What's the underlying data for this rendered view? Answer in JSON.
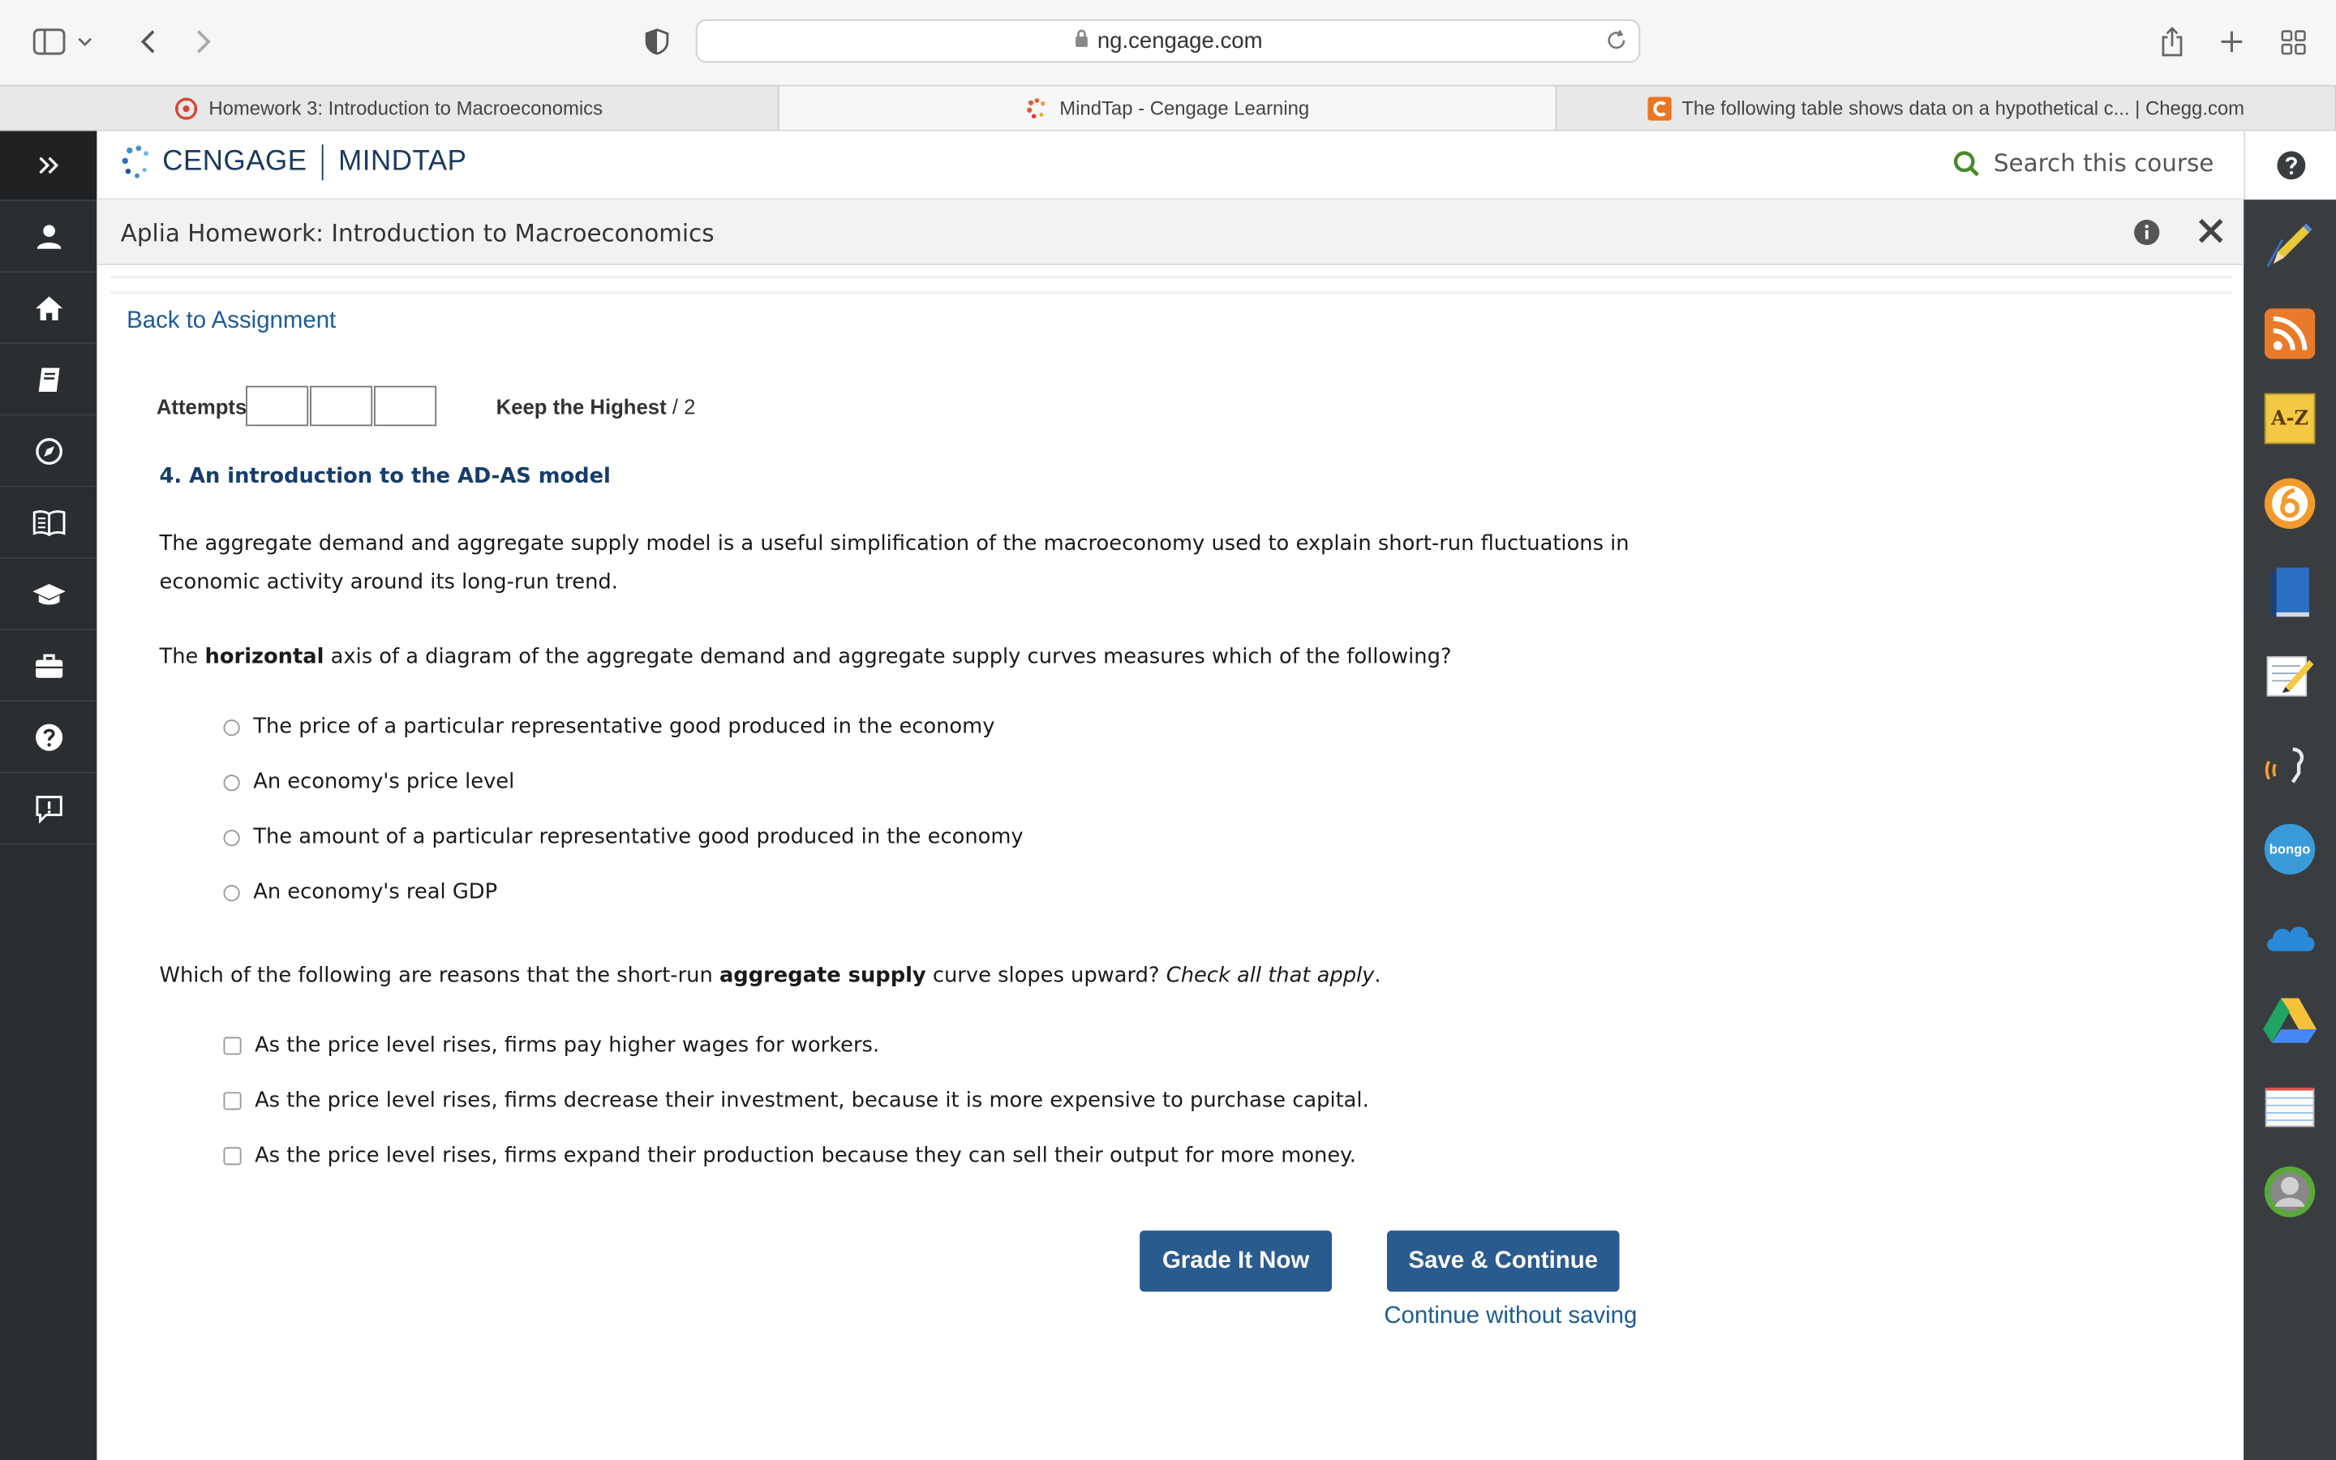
{
  "browser": {
    "url": "ng.cengage.com",
    "tabs": [
      {
        "label": "Homework 3: Introduction to Macroeconomics",
        "active": false
      },
      {
        "label": "MindTap - Cengage Learning",
        "active": true
      },
      {
        "label": "The following table shows data on a hypothetical c... | Chegg.com",
        "active": false
      }
    ]
  },
  "header": {
    "brand_left": "CENGAGE",
    "brand_right": "MINDTAP",
    "search_label": "Search this course"
  },
  "activity": {
    "title": "Aplia Homework: Introduction to Macroeconomics",
    "back_link": "Back to Assignment",
    "attempts_label": "Attempts",
    "keep_label": "Keep the Highest",
    "keep_suffix": "/ 2"
  },
  "question": {
    "heading": "4. An introduction to the AD-AS model",
    "intro": "The aggregate demand and aggregate supply model is a useful simplification of the macroeconomy used to explain short-run fluctuations in economic activity around its long-run trend.",
    "q1_pre": "The ",
    "q1_bold": "horizontal",
    "q1_post": " axis of a diagram of the aggregate demand and aggregate supply curves measures which of the following?",
    "q1_options": [
      "The price of a particular representative good produced in the economy",
      "An economy's price level",
      "The amount of a particular representative good produced in the economy",
      "An economy's real GDP"
    ],
    "q2_pre": "Which of the following are reasons that the short-run ",
    "q2_bold": "aggregate supply",
    "q2_mid": " curve slopes upward? ",
    "q2_italic": "Check all that apply",
    "q2_end": ".",
    "q2_options": [
      "As the price level rises, firms pay higher wages for workers.",
      "As the price level rises, firms decrease their investment, because it is more expensive to purchase capital.",
      "As the price level rises, firms expand their production because they can sell their output for more money."
    ]
  },
  "actions": {
    "grade": "Grade It Now",
    "save": "Save & Continue",
    "continue_without": "Continue without saving"
  },
  "dock_apps": {
    "az_label": "A-Z",
    "bongo_label": "bongo"
  },
  "colors": {
    "accent": "#2a5b8e",
    "link": "#1e5c94",
    "heading": "#163d6b",
    "nav_bg": "#2b2e30",
    "dock_bg": "#3a3d40"
  }
}
